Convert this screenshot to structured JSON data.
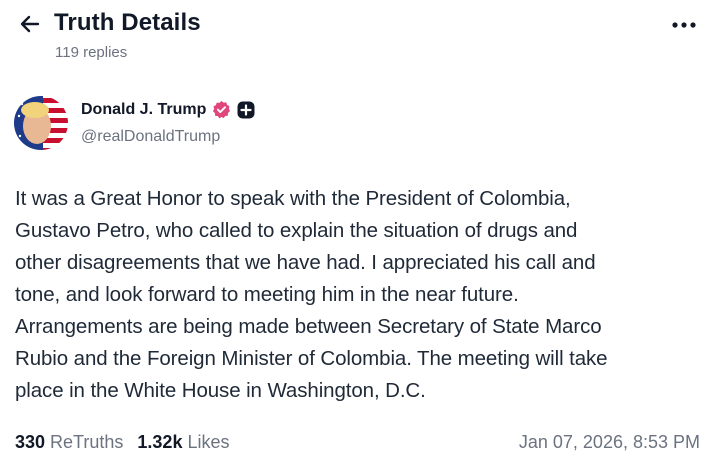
{
  "header": {
    "title": "Truth Details",
    "replies": "119 replies"
  },
  "author": {
    "name": "Donald J. Trump",
    "handle": "@realDonaldTrump",
    "verified_badge_color": "#e0457b"
  },
  "post": {
    "text": "It was a Great Honor to speak with the President of Colombia,\nGustavo Petro, who called to explain the situation of drugs and\nother disagreements that we have had. I appreciated his call and\ntone, and look forward to meeting him in the near future.\nArrangements are being made between Secretary of State Marco\nRubio and the Foreign Minister of Colombia. The meeting will take\nplace in the White House in Washington, D.C."
  },
  "stats": {
    "retruths_count": "330",
    "retruths_label": "ReTruths",
    "likes_count": "1.32k",
    "likes_label": "Likes",
    "timestamp": "Jan 07, 2026, 8:53 PM"
  },
  "icons": {
    "back": "arrow-left-icon",
    "more": "more-horizontal-icon",
    "verified": "verified-badge-icon",
    "follow": "plus-icon"
  }
}
